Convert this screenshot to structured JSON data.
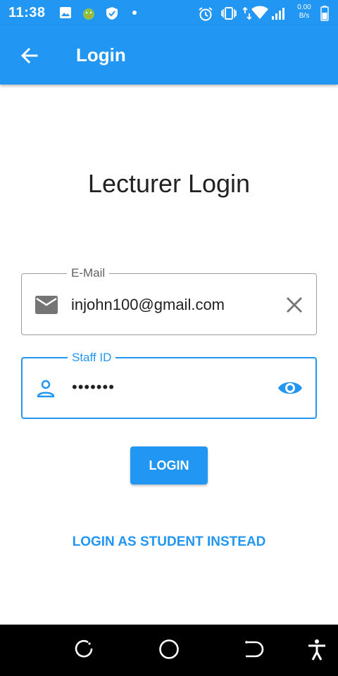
{
  "status_bar": {
    "time": "11:38",
    "net_speed_value": "0.00",
    "net_speed_unit": "B/s",
    "icons": [
      "image-icon",
      "android-icon",
      "shield-icon",
      "dot-icon",
      "alarm-icon",
      "vibrate-icon",
      "data-arrows-icon",
      "wifi-icon",
      "signal-icon",
      "battery-icon"
    ]
  },
  "app_bar": {
    "title": "Login",
    "back_icon": "arrow-back-icon",
    "background": "#2196f3"
  },
  "page": {
    "heading": "Lecturer Login"
  },
  "form": {
    "email": {
      "label": "E-Mail",
      "value": "injohn100@gmail.com",
      "left_icon": "mail-icon",
      "right_icon": "clear-icon"
    },
    "staff_id": {
      "label": "Staff ID",
      "value": "•••••••",
      "left_icon": "person-icon",
      "right_icon": "eye-icon"
    },
    "login_button": "LOGIN",
    "alt_link": "LOGIN AS STUDENT INSTEAD"
  },
  "nav_bar": {
    "icons": [
      "recent-apps-icon",
      "home-icon",
      "back-icon",
      "accessibility-icon"
    ]
  },
  "colors": {
    "accent": "#2196f3",
    "text": "#212121",
    "muted": "#616161"
  }
}
